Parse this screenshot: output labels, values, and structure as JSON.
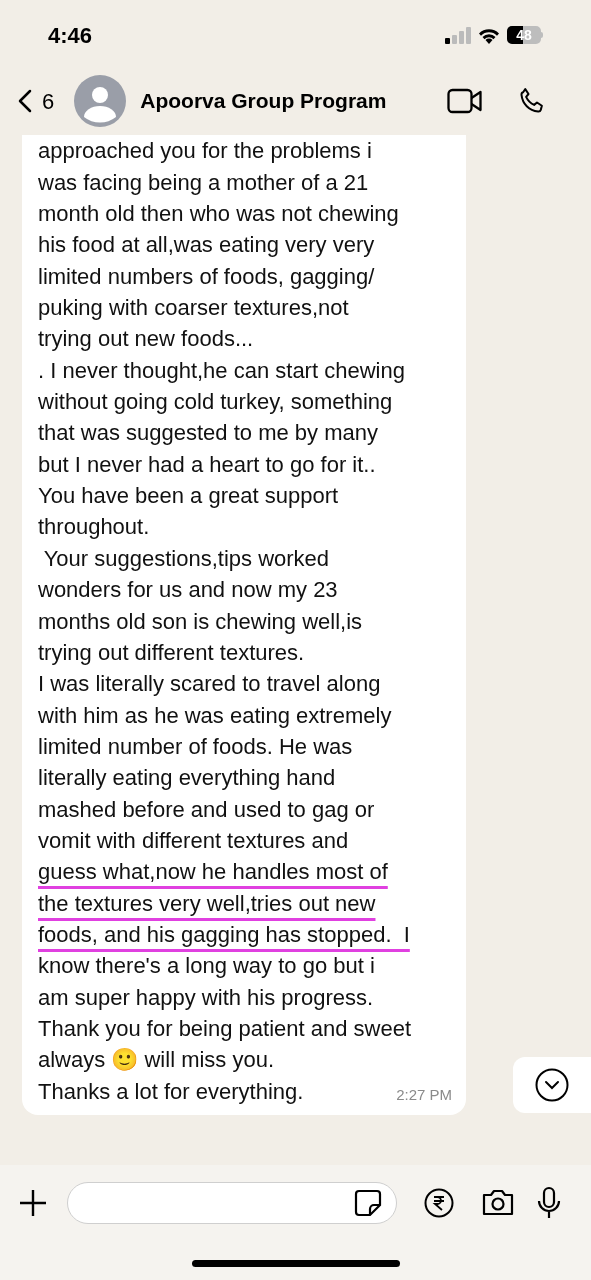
{
  "status_bar": {
    "time": "4:46",
    "battery": "48"
  },
  "header": {
    "back_count": "6",
    "title": "Apoorva Group Program"
  },
  "message": {
    "time": "2:27 PM",
    "lines": [
      {
        "text": "approached you for the problems i",
        "underlined": false
      },
      {
        "text": "was facing being a mother of a 21",
        "underlined": false
      },
      {
        "text": "month old then who was not chewing",
        "underlined": false
      },
      {
        "text": "his food at all,was eating very very",
        "underlined": false
      },
      {
        "text": "limited numbers of foods, gagging/",
        "underlined": false
      },
      {
        "text": "puking with coarser textures,not",
        "underlined": false
      },
      {
        "text": "trying out new foods...",
        "underlined": false
      },
      {
        "text": ". I never thought,he can start chewing",
        "underlined": false
      },
      {
        "text": "without going cold turkey, something",
        "underlined": false
      },
      {
        "text": "that was suggested to me by many",
        "underlined": false
      },
      {
        "text": "but I never had a heart to go for it..",
        "underlined": false
      },
      {
        "text": "You have been a great support",
        "underlined": false
      },
      {
        "text": "throughout.",
        "underlined": false
      },
      {
        "text": " Your suggestions,tips worked",
        "underlined": false
      },
      {
        "text": "wonders for us and now my 23",
        "underlined": false
      },
      {
        "text": "months old son is chewing well,is",
        "underlined": false
      },
      {
        "text": "trying out different textures.",
        "underlined": false
      },
      {
        "text": "I was literally scared to travel along",
        "underlined": false
      },
      {
        "text": "with him as he was eating extremely",
        "underlined": false
      },
      {
        "text": "limited number of foods. He was",
        "underlined": false
      },
      {
        "text": "literally eating everything hand",
        "underlined": false
      },
      {
        "text": "mashed before and used to gag or",
        "underlined": false
      },
      {
        "text": "vomit with different textures and",
        "underlined": false
      },
      {
        "text": "guess what,now he handles most of",
        "underlined": true
      },
      {
        "text": "the textures very well,tries out new",
        "underlined": true
      },
      {
        "text": "foods, and his gagging has stopped.  I",
        "underlined": true
      },
      {
        "text": "know there's a long way to go but i",
        "underlined": false
      },
      {
        "text": "am super happy with his progress.",
        "underlined": false
      },
      {
        "text": "Thank you for being patient and sweet",
        "underlined": false
      },
      {
        "text": "always 🙂 will miss you.",
        "underlined": false
      },
      {
        "text": "Thanks a lot for everything.",
        "underlined": false
      }
    ]
  }
}
